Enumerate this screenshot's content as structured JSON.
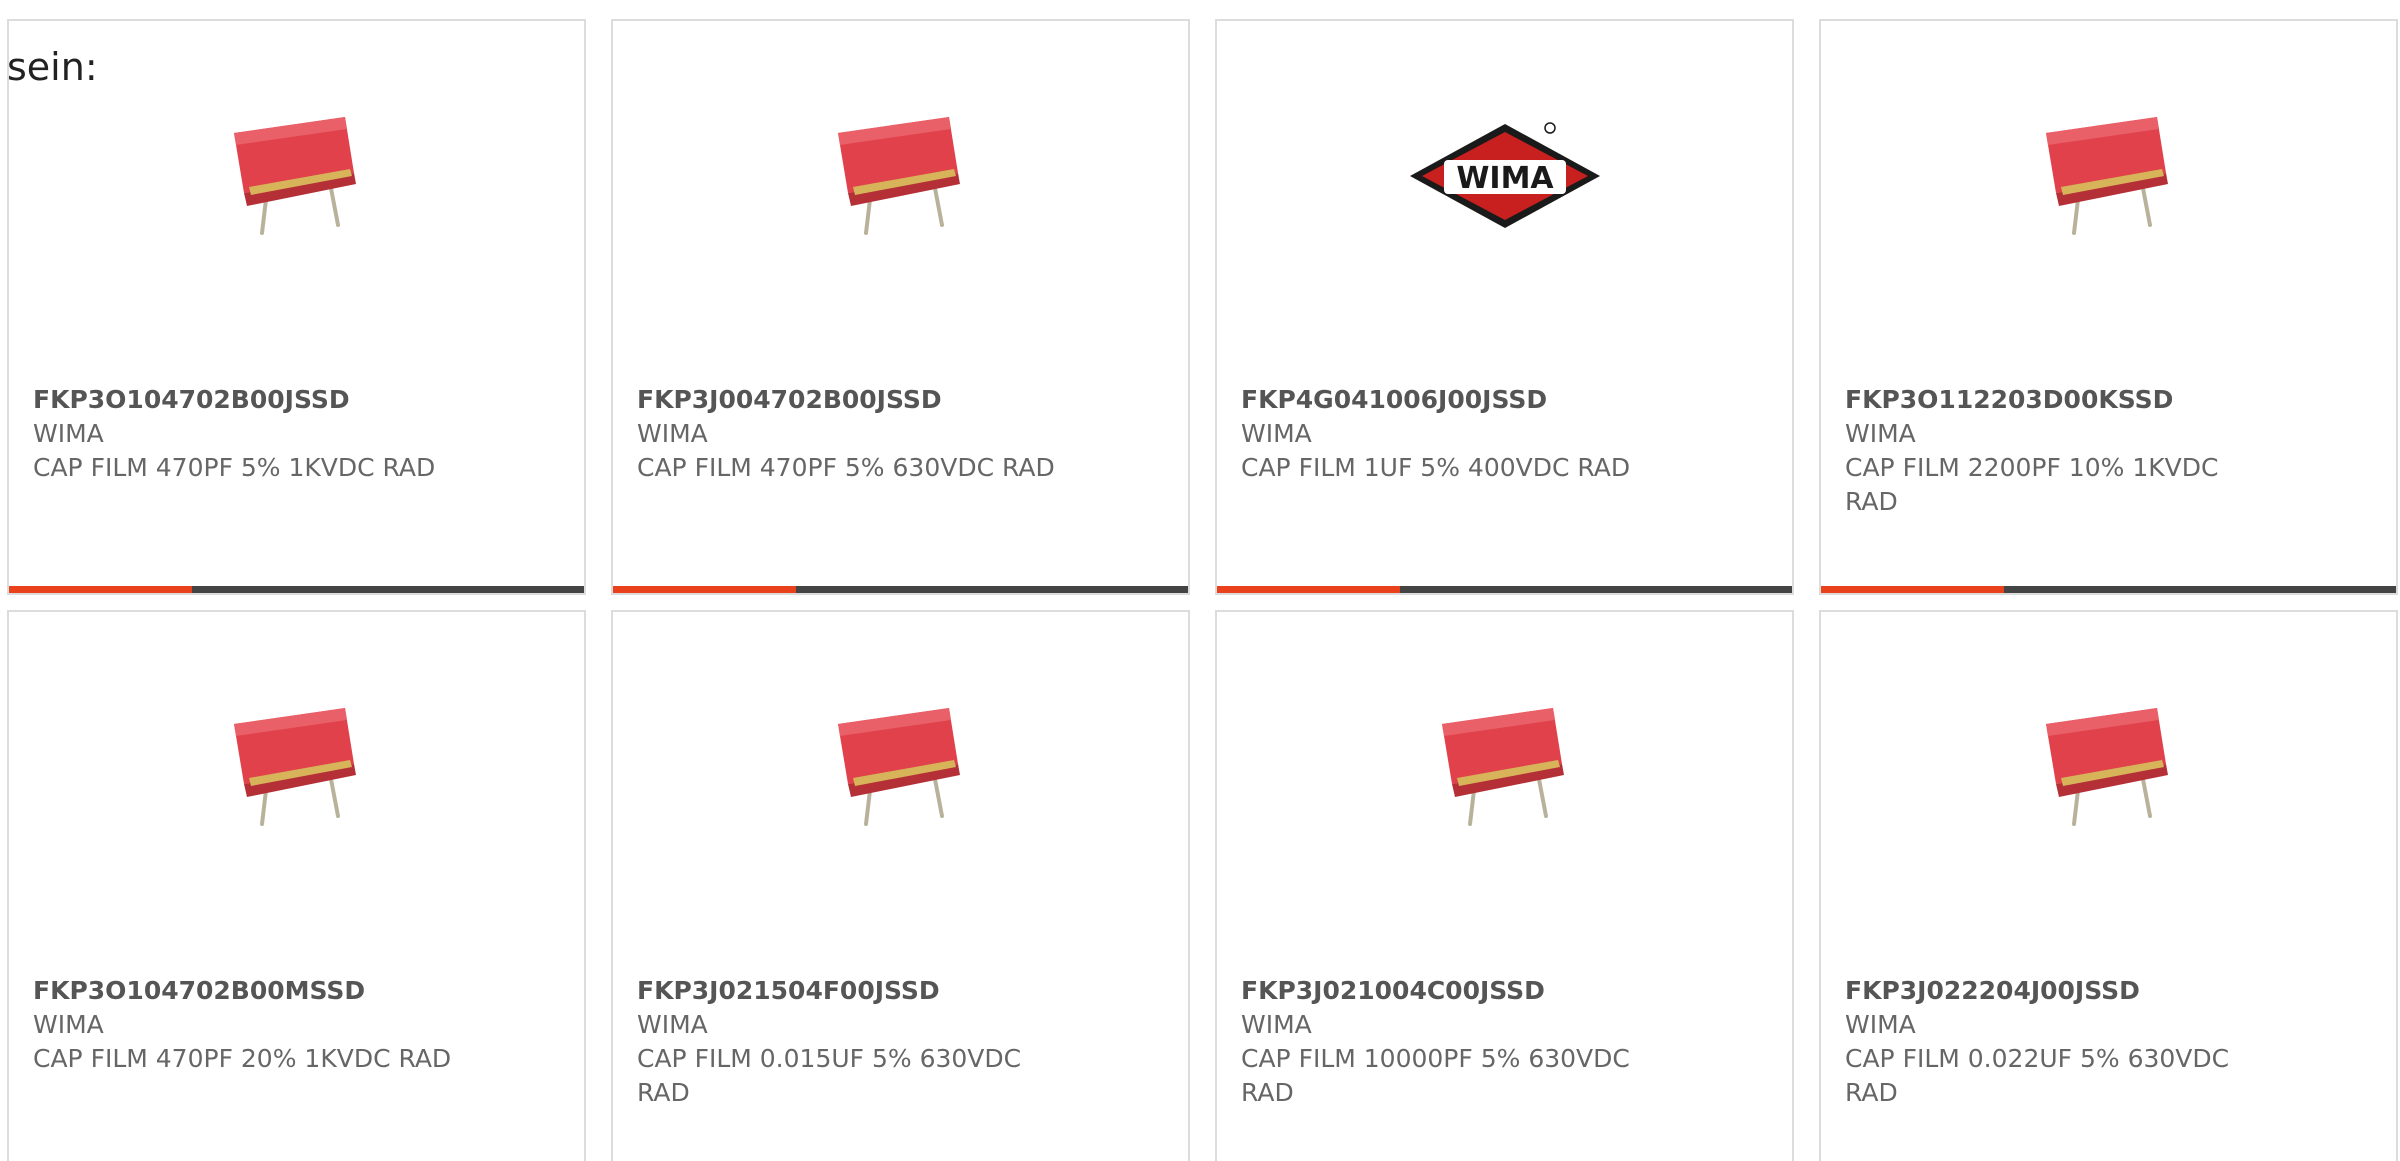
{
  "lead_text": "sein:",
  "colors": {
    "accent": "#e8411c",
    "bar_dark": "#444444",
    "card_border": "#dcdcdc",
    "capacitor_red": "#e0414a",
    "wima_red": "#c7201f"
  },
  "products": [
    {
      "part_number": "FKP3O104702B00JSSD",
      "manufacturer": "WIMA",
      "description": "CAP FILM 470PF 5% 1KVDC RAD",
      "image": "film-capacitor-image"
    },
    {
      "part_number": "FKP3J004702B00JSSD",
      "manufacturer": "WIMA",
      "description": "CAP FILM 470PF 5% 630VDC RAD",
      "image": "film-capacitor-image"
    },
    {
      "part_number": "FKP4G041006J00JSSD",
      "manufacturer": "WIMA",
      "description": "CAP FILM 1UF 5% 400VDC RAD",
      "image": "wima-logo",
      "logo_text": "WIMA"
    },
    {
      "part_number": "FKP3O112203D00KSSD",
      "manufacturer": "WIMA",
      "description": "CAP FILM 2200PF 10% 1KVDC RAD",
      "image": "film-capacitor-image"
    },
    {
      "part_number": "FKP3O104702B00MSSD",
      "manufacturer": "WIMA",
      "description": "CAP FILM 470PF 20% 1KVDC RAD",
      "image": "film-capacitor-image"
    },
    {
      "part_number": "FKP3J021504F00JSSD",
      "manufacturer": "WIMA",
      "description": "CAP FILM 0.015UF 5% 630VDC RAD",
      "image": "film-capacitor-image"
    },
    {
      "part_number": "FKP3J021004C00JSSD",
      "manufacturer": "WIMA",
      "description": "CAP FILM 10000PF 5% 630VDC RAD",
      "image": "film-capacitor-image"
    },
    {
      "part_number": "FKP3J022204J00JSSD",
      "manufacturer": "WIMA",
      "description": "CAP FILM 0.022UF 5% 630VDC RAD",
      "image": "film-capacitor-image"
    }
  ]
}
